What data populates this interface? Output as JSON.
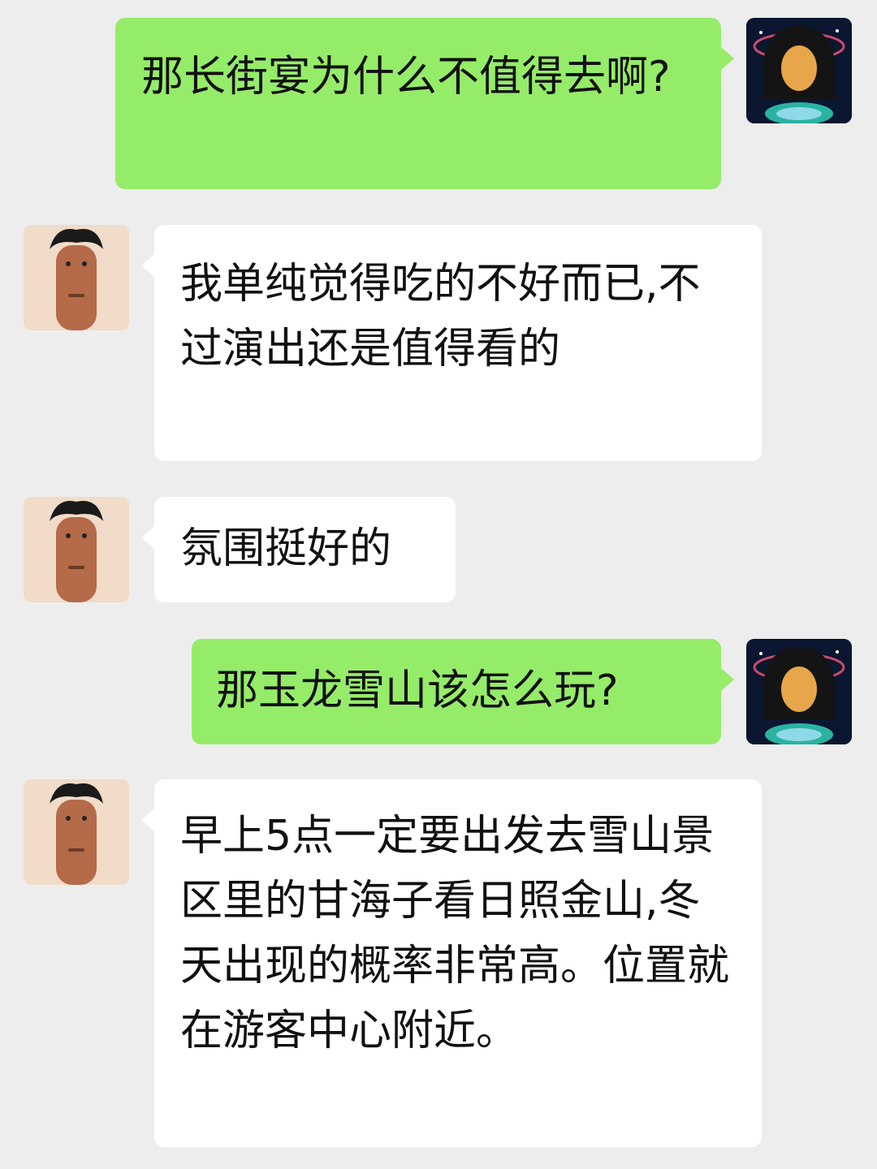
{
  "messages": [
    {
      "sender": "me",
      "avatar": "girl-galaxy-avatar",
      "text": "那长街宴为什么不值得去啊?"
    },
    {
      "sender": "other",
      "avatar": "man-long-face-avatar",
      "text": "我单纯觉得吃的不好而已,不过演出还是值得看的"
    },
    {
      "sender": "other",
      "avatar": "man-long-face-avatar",
      "text": "氛围挺好的"
    },
    {
      "sender": "me",
      "avatar": "girl-galaxy-avatar",
      "text": "那玉龙雪山该怎么玩?"
    },
    {
      "sender": "other",
      "avatar": "man-long-face-avatar",
      "text": "早上5点一定要出发去雪山景区里的甘海子看日照金山,冬天出现的概率非常高。位置就在游客中心附近。"
    }
  ],
  "colors": {
    "background": "#ededed",
    "bubble_me": "#95ec69",
    "bubble_other": "#ffffff"
  }
}
